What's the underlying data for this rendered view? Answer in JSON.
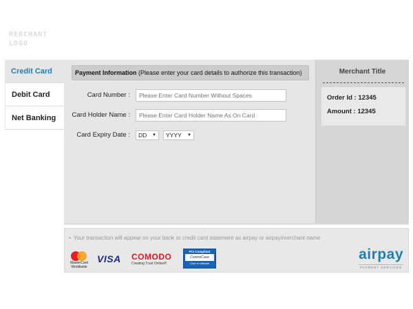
{
  "logo": {
    "line1": "MERCHANT",
    "line2": "LOGO"
  },
  "tabs": [
    {
      "label": "Credit Card",
      "active": true
    },
    {
      "label": "Debit Card",
      "active": false
    },
    {
      "label": "Net Banking",
      "active": false
    }
  ],
  "form": {
    "header_bold": "Payment Information",
    "header_rest": " (Please enter your card details to authorize this transaction)",
    "card_number": {
      "label": "Card Number :",
      "placeholder": "Please Enter Card Number Without Spaces",
      "value": ""
    },
    "holder_name": {
      "label": "Card Holder Name :",
      "placeholder": "Please Enter Card Holder Name As On Card",
      "value": ""
    },
    "expiry": {
      "label": "Card Expiry Date :",
      "day_selected": "DD",
      "year_selected": "YYYY"
    }
  },
  "merchant": {
    "title": "Merchant Title",
    "order_id": "Order Id : 12345",
    "amount": "Amount : 12345"
  },
  "footer": {
    "note": "Your transaction will appear on your bank or credit card statement as airpay or airpay/merchant name",
    "logos": {
      "mastercard_line1": "MasterCard",
      "mastercard_line2": "Worldwide",
      "visa": "VISA",
      "comodo": "COMODO",
      "comodo_tag": "Creating Trust Online®",
      "pci_top": "PCI Compliant",
      "pci_mid": "ControlCase",
      "pci_bottom": "Click to Validate",
      "airpay": "airpay",
      "airpay_tag": "PAYMENT SERVICES"
    }
  },
  "colors": {
    "accent": "#1f7fb3",
    "panel": "#e6e6e6",
    "sidebar": "#d5d5d5"
  }
}
